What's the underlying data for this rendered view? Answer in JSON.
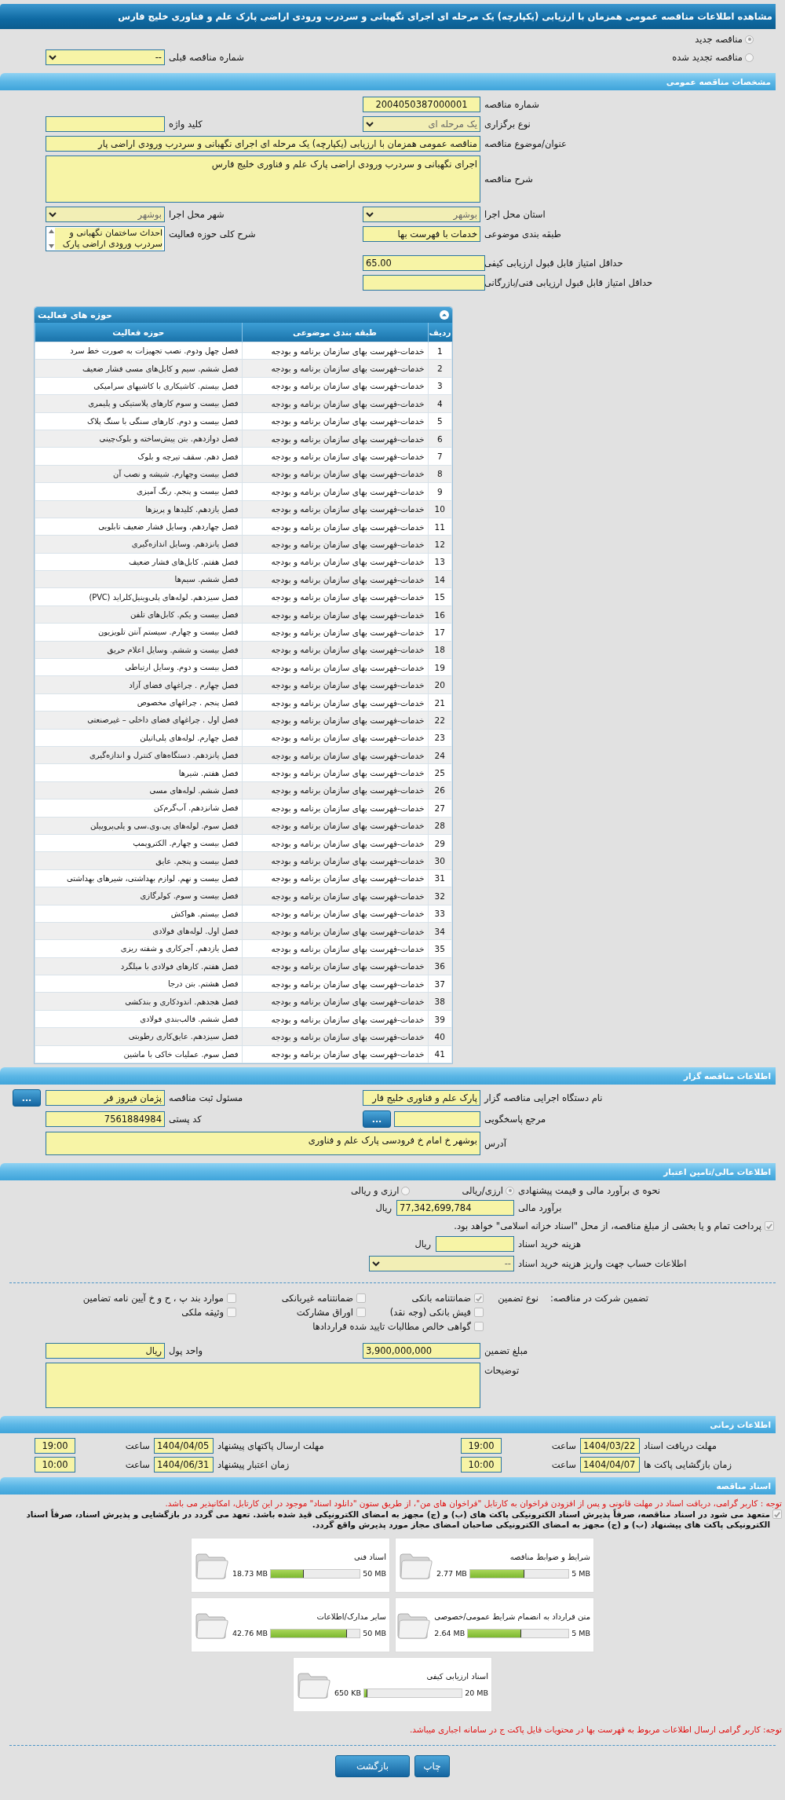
{
  "title": "مشاهده اطلاعات مناقصه عمومی همزمان با ارزیابی (یکپارچه) یک مرحله ای اجرای نگهبانی و سردرب ورودی اراضی پارک علم و فناوری خلیج فارس",
  "tender_kind": [
    {
      "label": "مناقصه جدید",
      "selected": true
    },
    {
      "label": "مناقصه تجدید شده",
      "selected": false
    }
  ],
  "previous_tender": {
    "label": "شماره مناقصه قبلی",
    "value": "--"
  },
  "general": {
    "heading": "مشخصات مناقصه عمومی",
    "tender_number": {
      "label": "شماره مناقصه",
      "value": "2004050387000001"
    },
    "holding_type": {
      "label": "نوع برگزاری",
      "value": "یک مرحله ای"
    },
    "keyword": {
      "label": "کلید واژه"
    },
    "subject": {
      "label": "عنوان/موضوع مناقصه",
      "value": "مناقصه عمومی همزمان با ارزیابی (یکپارچه) یک مرحله ای اجرای نگهبانی و سردرب ورودی اراضی پار"
    },
    "description": {
      "label": "شرح مناقصه",
      "value": "اجرای نگهبانی و سردرب ورودی اراضی پارک علم و فناوری خلیج فارس"
    },
    "province": {
      "label": "استان محل اجرا",
      "value": "بوشهر"
    },
    "city": {
      "label": "شهر محل اجرا",
      "value": "بوشهر"
    },
    "category": {
      "label": "طبقه بندی موضوعی",
      "value": "خدمات با فهرست بها"
    },
    "activity_summary": {
      "label": "شرح کلی حوزه فعالیت",
      "value": "احداث ساختمان نگهبانی و سردرب ورودی اراضی پارک"
    },
    "min_quality_score": {
      "label": "حداقل امتیاز قابل قبول ارزیابی کیفی",
      "value": "65.00"
    },
    "min_technical_score": {
      "label": "حداقل امتیاز قابل قبول ارزیابی فنی/بازرگانی"
    }
  },
  "activities": {
    "heading": "حوزه های فعالیت",
    "columns": [
      "ردیف",
      "طبقه بندی موضوعی",
      "حوزه فعالیت"
    ],
    "rows": [
      [
        "1",
        "خدمات-فهرست بهای سازمان برنامه و بودجه",
        "فصل چهل ودوم. نصب تجهیزات به صورت خط سرد"
      ],
      [
        "2",
        "خدمات-فهرست بهای سازمان برنامه و بودجه",
        "فصل ششم. سیم و کابل‌های مسی فشار ضعیف"
      ],
      [
        "3",
        "خدمات-فهرست بهای سازمان برنامه و بودجه",
        "فصل بیستم. کاشیکاری با کاشیهای سرامیکی"
      ],
      [
        "4",
        "خدمات-فهرست بهای سازمان برنامه و بودجه",
        "فصل بیست و سوم کارهای پلاستیکی و پلیمری"
      ],
      [
        "5",
        "خدمات-فهرست بهای سازمان برنامه و بودجه",
        "فصل بیست و دوم. کارهای سنگی با سنگ پلاک"
      ],
      [
        "6",
        "خدمات-فهرست بهای سازمان برنامه و بودجه",
        "فصل دوازدهم. بتن پیش‌ساخته و بلوک‌چینی"
      ],
      [
        "7",
        "خدمات-فهرست بهای سازمان برنامه و بودجه",
        "فصل دهم. سقف تیرچه و بلوک"
      ],
      [
        "8",
        "خدمات-فهرست بهای سازمان برنامه و بودجه",
        "فصل بیست وچهارم. شیشه و نصب آن"
      ],
      [
        "9",
        "خدمات-فهرست بهای سازمان برنامه و بودجه",
        "فصل بیست و پنجم. رنگ آمیزی"
      ],
      [
        "10",
        "خدمات-فهرست بهای سازمان برنامه و بودجه",
        "فصل یازدهم. کلیدها و پریزها"
      ],
      [
        "11",
        "خدمات-فهرست بهای سازمان برنامه و بودجه",
        "فصل چهاردهم. وسایل فشار ضعیف تابلویی"
      ],
      [
        "12",
        "خدمات-فهرست بهای سازمان برنامه و بودجه",
        "فصل پانزدهم. وسایل اندازه‌گیری"
      ],
      [
        "13",
        "خدمات-فهرست بهای سازمان برنامه و بودجه",
        "فصل هفتم. کابل‌های فشار ضعیف"
      ],
      [
        "14",
        "خدمات-فهرست بهای سازمان برنامه و بودجه",
        "فصل ششم. سیم‌ها"
      ],
      [
        "15",
        "خدمات-فهرست بهای سازمان برنامه و بودجه",
        "فصل سیزدهم. لوله‌های پلی‌وینیل‌کلراید (PVC)"
      ],
      [
        "16",
        "خدمات-فهرست بهای سازمان برنامه و بودجه",
        "فصل بیست و یکم. کابل‌های تلفن"
      ],
      [
        "17",
        "خدمات-فهرست بهای سازمان برنامه و بودجه",
        "فصل بیست و چهارم. سیستم آنتن تلویزیون"
      ],
      [
        "18",
        "خدمات-فهرست بهای سازمان برنامه و بودجه",
        "فصل بیست و ششم. وسایل اعلام حریق"
      ],
      [
        "19",
        "خدمات-فهرست بهای سازمان برنامه و بودجه",
        "فصل بیست و دوم. وسایل ارتباطی"
      ],
      [
        "20",
        "خدمات-فهرست بهای سازمان برنامه و بودجه",
        "فصل چهارم . چراغهای فضای آزاد"
      ],
      [
        "21",
        "خدمات-فهرست بهای سازمان برنامه و بودجه",
        "فصل پنجم . چراغهای مخصوص"
      ],
      [
        "22",
        "خدمات-فهرست بهای سازمان برنامه و بودجه",
        "فصل اول . چراغهای فضای داخلی – غیرصنعتی"
      ],
      [
        "23",
        "خدمات-فهرست بهای سازمان برنامه و بودجه",
        "فصل چهارم. لوله‌های پلی‌اتیلن"
      ],
      [
        "24",
        "خدمات-فهرست بهای سازمان برنامه و بودجه",
        "فصل پانزدهم. دستگاه‌های کنترل و اندازه‌گیری"
      ],
      [
        "25",
        "خدمات-فهرست بهای سازمان برنامه و بودجه",
        "فصل هفتم. شیرها"
      ],
      [
        "26",
        "خدمات-فهرست بهای سازمان برنامه و بودجه",
        "فصل ششم. لوله‌های مسی"
      ],
      [
        "27",
        "خدمات-فهرست بهای سازمان برنامه و بودجه",
        "فصل شانزدهم. آب‌گرم‌کن"
      ],
      [
        "28",
        "خدمات-فهرست بهای سازمان برنامه و بودجه",
        "فصل سوم. لوله‌های پی.وی.سی و پلی‌پروپیلن"
      ],
      [
        "29",
        "خدمات-فهرست بهای سازمان برنامه و بودجه",
        "فصل بیست و چهارم. الکتروپمپ"
      ],
      [
        "30",
        "خدمات-فهرست بهای سازمان برنامه و بودجه",
        "فصل بیست و پنجم. عایق"
      ],
      [
        "31",
        "خدمات-فهرست بهای سازمان برنامه و بودجه",
        "فصل بیست و نهم. لوازم بهداشتی، شیرهای بهداشتی"
      ],
      [
        "32",
        "خدمات-فهرست بهای سازمان برنامه و بودجه",
        "فصل بیست و سوم. کولرگازی"
      ],
      [
        "33",
        "خدمات-فهرست بهای سازمان برنامه و بودجه",
        "فصل بیستم. هواکش"
      ],
      [
        "34",
        "خدمات-فهرست بهای سازمان برنامه و بودجه",
        "فصل اول. لوله‌های فولادی"
      ],
      [
        "35",
        "خدمات-فهرست بهای سازمان برنامه و بودجه",
        "فصل یازدهم. آجرکاری و شفته ریزی"
      ],
      [
        "36",
        "خدمات-فهرست بهای سازمان برنامه و بودجه",
        "فصل هفتم. کارهای فولادی با میلگرد"
      ],
      [
        "37",
        "خدمات-فهرست بهای سازمان برنامه و بودجه",
        "فصل هشتم. بتن درجا"
      ],
      [
        "38",
        "خدمات-فهرست بهای سازمان برنامه و بودجه",
        "فصل هجدهم. اندودکاری و بندکشی"
      ],
      [
        "39",
        "خدمات-فهرست بهای سازمان برنامه و بودجه",
        "فصل ششم. قالب‌بندی فولادی"
      ],
      [
        "40",
        "خدمات-فهرست بهای سازمان برنامه و بودجه",
        "فصل سیزدهم. عایق‌کاری رطوبتی"
      ],
      [
        "41",
        "خدمات-فهرست بهای سازمان برنامه و بودجه",
        "فصل سوم. عملیات خاکی با ماشین"
      ]
    ]
  },
  "organizer": {
    "heading": "اطلاعات مناقصه گزار",
    "agency": {
      "label": "نام دستگاه اجرایی مناقصه گزار",
      "value": "پارک علم و فناوری خلیج فار"
    },
    "registrar": {
      "label": "مسئول ثبت مناقصه",
      "value": "پژمان فیروز فر",
      "button": "..."
    },
    "reference": {
      "label": "مرجع پاسخگویی",
      "button": "..."
    },
    "postal_code": {
      "label": "کد پستی",
      "value": "7561884984"
    },
    "address": {
      "label": "آدرس",
      "value": "بوشهر خ امام خ فرودسی پارک علم و فناوری"
    }
  },
  "finance": {
    "heading": "اطلاعات مالی/تامین اعتبار",
    "estimate_method": {
      "label": "نحوه ی برآورد مالی و قیمت پیشنهادی",
      "options": [
        {
          "label": "ارزی/ریالی",
          "selected": true
        },
        {
          "label": "ارزی و ریالی",
          "selected": false
        }
      ]
    },
    "estimate": {
      "label": "برآورد مالی",
      "value": "77,342,699,784",
      "unit": "ریال"
    },
    "treasury": {
      "label": "پرداخت تمام و یا بخشی از مبلغ مناقصه، از محل \"اسناد خزانه اسلامی\" خواهد بود.",
      "checked": true
    },
    "doc_fee": {
      "label": "هزینه خرید اسناد",
      "unit": "ریال"
    },
    "account": {
      "label": "اطلاعات حساب جهت واریز هزینه خرید اسناد",
      "value": "--"
    }
  },
  "guarantee": {
    "label": "تضمین شرکت در مناقصه:",
    "type_label": "نوع تضمین",
    "options": [
      {
        "label": "ضمانتنامه بانکی",
        "checked": true
      },
      {
        "label": "ضمانتنامه غیربانکی",
        "checked": false
      },
      {
        "label": "موارد بند پ ، ح و خ آیین نامه تضامین",
        "checked": false
      },
      {
        "label": "فیش بانکی (وجه نقد)",
        "checked": false
      },
      {
        "label": "اوراق مشارکت",
        "checked": false
      },
      {
        "label": "وثیقه ملکی",
        "checked": false
      },
      {
        "label": "گواهی خالص مطالبات تایید شده قراردادها",
        "checked": false
      }
    ],
    "amount": {
      "label": "مبلغ تضمین",
      "value": "3,900,000,000"
    },
    "currency": {
      "label": "واحد پول",
      "value": "ریال"
    },
    "notes": {
      "label": "توضیحات"
    }
  },
  "timing": {
    "heading": "اطلاعات زمانی",
    "rows": [
      {
        "label": "مهلت دریافت اسناد",
        "date": "1404/03/22",
        "time_label": "ساعت",
        "time": "19:00"
      },
      {
        "label": "مهلت ارسال پاکتهای پیشنهاد",
        "date": "1404/04/05",
        "time_label": "ساعت",
        "time": "19:00"
      },
      {
        "label": "زمان بازگشایی پاکت ها",
        "date": "1404/04/07",
        "time_label": "ساعت",
        "time": "10:00"
      },
      {
        "label": "زمان اعتبار پیشنهاد",
        "date": "1404/06/31",
        "time_label": "ساعت",
        "time": "10:00"
      }
    ]
  },
  "documents": {
    "heading": "اسناد مناقصه",
    "notice": "توجه : کاربر گرامی، دریافت اسناد در مهلت قانونی و پس از افزودن فراخوان به کارتابل \"فراخوان های من\"، از طریق ستون \"دانلود اسناد\" موجود در این کارتابل، امکانپذیر می باشد.",
    "commitment": {
      "text": "متعهد می شود در اسناد مناقصه، صرفاً پذیرش اسناد الکترونیکی پاکت های (ب) و (ج) مجهز به امضای الکترونیکی قید شده باشد. تعهد می گردد در بازگشایی و پذیرش اسناد، صرفاً اسناد الکترونیکی پاکت های پیشنهاد (ب) و (ج) مجهز به امضای الکترونیکی صاحبان امضای مجاز مورد پذیرش واقع گردد.",
      "checked": true
    },
    "files": [
      {
        "name": "شرایط و ضوابط مناقصه",
        "used": "2.77 MB",
        "limit": "5 MB",
        "level": 0.554
      },
      {
        "name": "اسناد فنی",
        "used": "18.73 MB",
        "limit": "50 MB",
        "level": 0.375
      },
      {
        "name": "متن قرارداد به انضمام شرایط عمومی/خصوصی",
        "used": "2.64 MB",
        "limit": "5 MB",
        "level": 0.528
      },
      {
        "name": "سایر مدارک/اطلاعات",
        "used": "42.76 MB",
        "limit": "50 MB",
        "level": 0.855
      },
      {
        "name": "اسناد ارزیابی کیفی",
        "used": "650 KB",
        "limit": "20 MB",
        "level": 0.032
      }
    ],
    "footer_notice": "توجه: کاربر گرامی ارسال اطلاعات مربوط به فهرست بها در محتویات فایل پاکت ج در سامانه اجباری میباشد."
  },
  "buttons": [
    "چاپ",
    "بازگشت"
  ]
}
